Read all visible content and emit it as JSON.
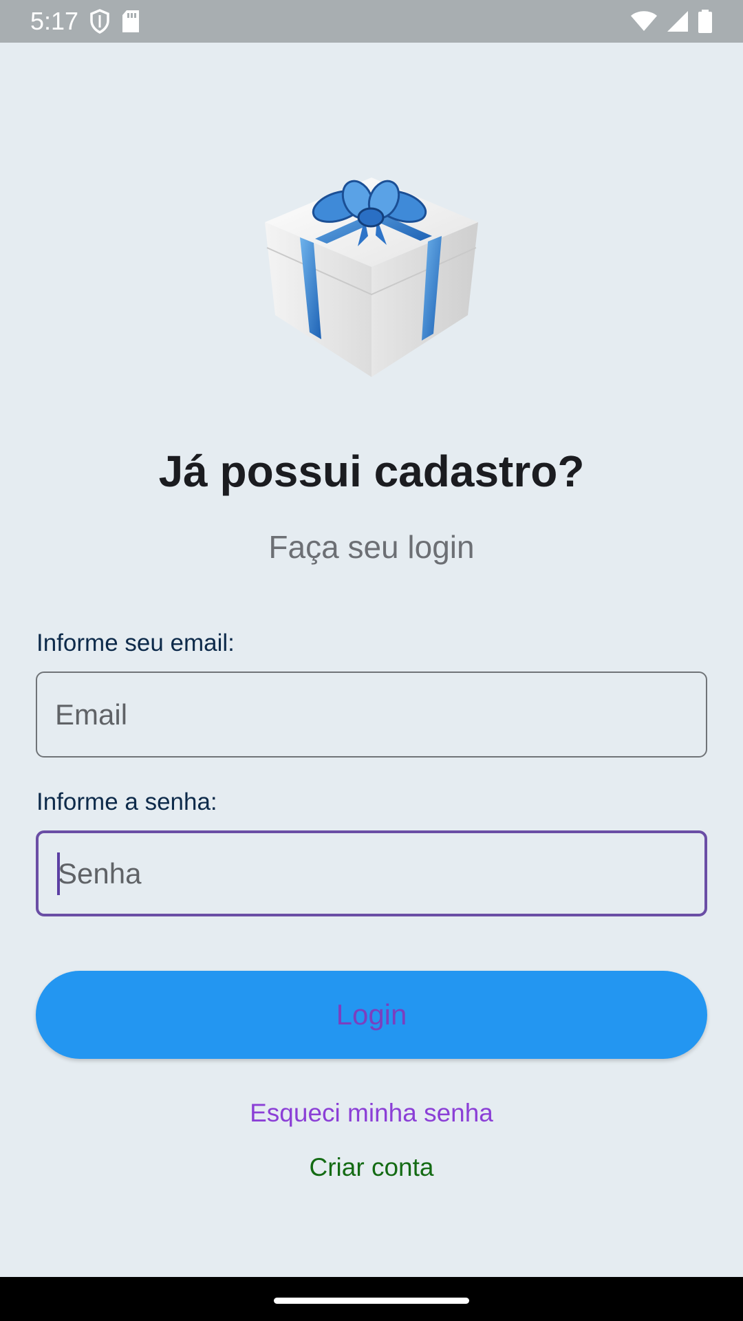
{
  "status_bar": {
    "time": "5:17",
    "icons": [
      "shield-icon",
      "sd-card-icon",
      "wifi-icon",
      "signal-icon",
      "battery-icon"
    ]
  },
  "hero": {
    "image": "gift-box-icon",
    "title": "Já possui cadastro?",
    "subtitle": "Faça seu login"
  },
  "form": {
    "email_label": "Informe seu email:",
    "email_placeholder": "Email",
    "password_label": "Informe a senha:",
    "password_placeholder": "Senha",
    "login_button": "Login"
  },
  "links": {
    "forgot_password": "Esqueci minha senha",
    "create_account": "Criar conta"
  },
  "colors": {
    "background": "#e5ecf1",
    "status_bar": "#a8aeb1",
    "button": "#2396f1",
    "button_text": "#7b3fbf",
    "focus_border": "#6a4ea5",
    "forgot_link": "#8b3fd6",
    "create_link": "#146b14"
  }
}
